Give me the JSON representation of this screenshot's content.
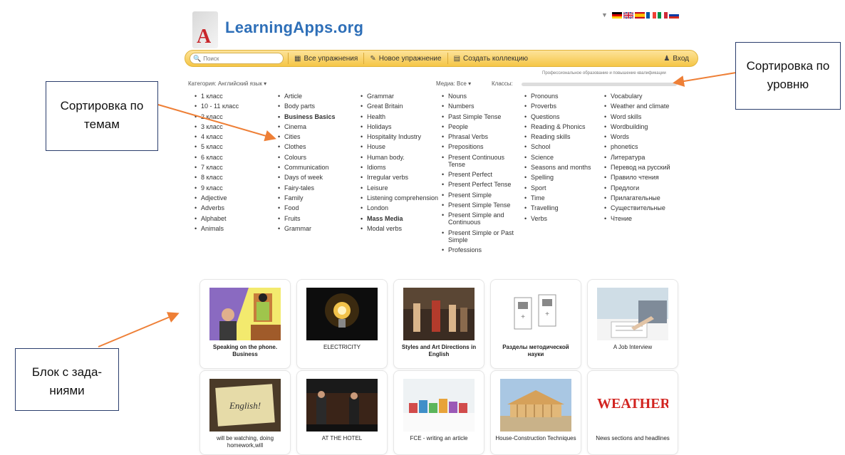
{
  "site": {
    "logo_text": "LearningApps.org"
  },
  "languages": [
    "de",
    "en",
    "es",
    "fr",
    "it",
    "ru"
  ],
  "toolbar": {
    "search_placeholder": "Поиск",
    "all_exercises": "Все упражнения",
    "new_exercise": "Новое упражнение",
    "create_collection": "Создать коллекцию",
    "login": "Вход"
  },
  "filters": {
    "category_label": "Категория: Английский язык",
    "media_label": "Медиа: Все",
    "classes_label": "Классы:",
    "classes_caption": "Профессиональное образование и повышение квалификации"
  },
  "categories": [
    [
      {
        "t": "1 класс"
      },
      {
        "t": "10 - 11 класс"
      },
      {
        "t": "2 класс"
      },
      {
        "t": "3 класс"
      },
      {
        "t": "4 класс"
      },
      {
        "t": "5 класс"
      },
      {
        "t": "6 класс"
      },
      {
        "t": "7 класс"
      },
      {
        "t": "8 класс"
      },
      {
        "t": "9 класс"
      },
      {
        "t": "Adjective"
      },
      {
        "t": "Adverbs"
      },
      {
        "t": "Alphabet"
      },
      {
        "t": "Animals"
      }
    ],
    [
      {
        "t": "Article"
      },
      {
        "t": "Body parts"
      },
      {
        "t": "Business Basics",
        "b": 1
      },
      {
        "t": "Cinema"
      },
      {
        "t": "Cities"
      },
      {
        "t": "Clothes"
      },
      {
        "t": "Colours"
      },
      {
        "t": "Communication"
      },
      {
        "t": "Days of week"
      },
      {
        "t": "Fairy-tales"
      },
      {
        "t": "Family"
      },
      {
        "t": "Food"
      },
      {
        "t": "Fruits"
      },
      {
        "t": "Grammar"
      }
    ],
    [
      {
        "t": "Grammar"
      },
      {
        "t": "Great Britain"
      },
      {
        "t": "Health"
      },
      {
        "t": "Holidays"
      },
      {
        "t": "Hospitality Industry"
      },
      {
        "t": "House"
      },
      {
        "t": "Human body."
      },
      {
        "t": "Idioms"
      },
      {
        "t": "Irregular verbs"
      },
      {
        "t": "Leisure"
      },
      {
        "t": "Listening comprehension"
      },
      {
        "t": "London"
      },
      {
        "t": "Mass Media",
        "b": 1
      },
      {
        "t": "Modal verbs"
      }
    ],
    [
      {
        "t": "Nouns"
      },
      {
        "t": "Numbers"
      },
      {
        "t": "Past Simple Tense"
      },
      {
        "t": "People"
      },
      {
        "t": "Phrasal Verbs"
      },
      {
        "t": "Prepositions"
      },
      {
        "t": "Present Continuous Tense"
      },
      {
        "t": "Present Perfect"
      },
      {
        "t": "Present Perfect Tense"
      },
      {
        "t": "Present Simple"
      },
      {
        "t": "Present Simple Tense"
      },
      {
        "t": "Present Simple and Continuous"
      },
      {
        "t": "Present Simple or Past Simple"
      },
      {
        "t": "Professions"
      }
    ],
    [
      {
        "t": "Pronouns"
      },
      {
        "t": "Proverbs"
      },
      {
        "t": "Questions"
      },
      {
        "t": "Reading & Phonics"
      },
      {
        "t": "Reading skills"
      },
      {
        "t": "School"
      },
      {
        "t": "Science"
      },
      {
        "t": "Seasons and months"
      },
      {
        "t": "Spelling"
      },
      {
        "t": "Sport"
      },
      {
        "t": "Time"
      },
      {
        "t": "Travelling"
      },
      {
        "t": "Verbs"
      }
    ],
    [
      {
        "t": "Vocabulary"
      },
      {
        "t": "Weather and climate"
      },
      {
        "t": "Word skills"
      },
      {
        "t": "Wordbuilding"
      },
      {
        "t": "Words"
      },
      {
        "t": "phonetics"
      },
      {
        "t": "Литература"
      },
      {
        "t": "Перевод на русский"
      },
      {
        "t": "Правило чтения"
      },
      {
        "t": "Предлоги"
      },
      {
        "t": "Прилагательные"
      },
      {
        "t": "Существительные"
      },
      {
        "t": "Чтение"
      }
    ]
  ],
  "cards": [
    {
      "title": "Speaking on the phone. Business",
      "bold": true,
      "thumb": "phone"
    },
    {
      "title": "ELECTRICITY",
      "bold": false,
      "thumb": "bulb"
    },
    {
      "title": "Styles and Art Directions in English",
      "bold": true,
      "thumb": "painting"
    },
    {
      "title": "Разделы методической науки",
      "bold": true,
      "thumb": "docs"
    },
    {
      "title": "A Job Interview",
      "bold": false,
      "thumb": "interview"
    },
    {
      "title": "will be watching, doing homework,will",
      "bold": false,
      "thumb": "paper"
    },
    {
      "title": "AT THE HOTEL",
      "bold": false,
      "thumb": "hotel"
    },
    {
      "title": "FCE - writing an article",
      "bold": false,
      "thumb": "houses"
    },
    {
      "title": "House-Construction Techniques",
      "bold": false,
      "thumb": "construction"
    },
    {
      "title": "News sections and headlines",
      "bold": false,
      "thumb": "weather",
      "thumb_text": "WEATHER"
    }
  ],
  "annotations": {
    "topics": "Сортировка по темам",
    "level": "Сортировка по уровню",
    "tasks": "Блок с зада-ниями"
  },
  "accent_colors": {
    "toolbar": "#f5c646",
    "arrow": "#ee7f36",
    "callout_border": "#2b3e6d",
    "logo": "#2e6fb8"
  }
}
